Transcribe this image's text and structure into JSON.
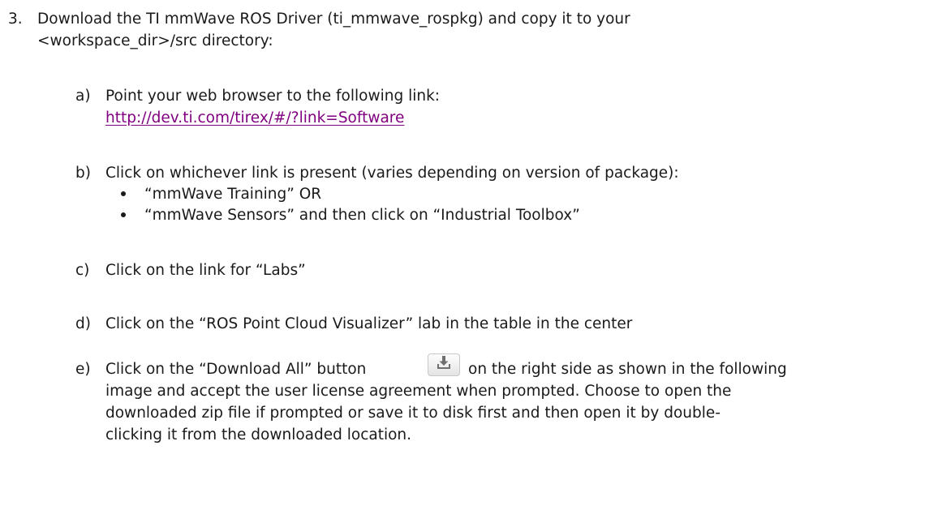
{
  "step3": {
    "number": "3.",
    "line1": "Download the TI mmWave ROS Driver (ti_mmwave_rospkg) and copy it to your",
    "line2": "<workspace_dir>/src directory:"
  },
  "step_a": {
    "label": "a)",
    "text": "Point your web browser to the following link:",
    "link": "http://dev.ti.com/tirex/#/?link=Software"
  },
  "step_b": {
    "label": "b)",
    "text": "Click on whichever link is present (varies depending on version of package):",
    "bullets": [
      "“mmWave Training” OR",
      "“mmWave Sensors” and then click on “Industrial Toolbox”"
    ]
  },
  "step_c": {
    "label": "c)",
    "text": "Click on the link for “Labs”"
  },
  "step_d": {
    "label": "d)",
    "text": "Click on the “ROS Point Cloud Visualizer” lab in the table in the center"
  },
  "step_e": {
    "label": "e)",
    "text_before_button": "Click on the “Download All” button",
    "text_after_button": "on the right side as shown in the following",
    "line2": "image and accept the user license agreement when prompted.  Choose to open the",
    "line3": "downloaded zip file if prompted or save it to disk first and then open it by double-",
    "line4": "clicking it from the downloaded location.",
    "button_icon": "download-icon"
  }
}
